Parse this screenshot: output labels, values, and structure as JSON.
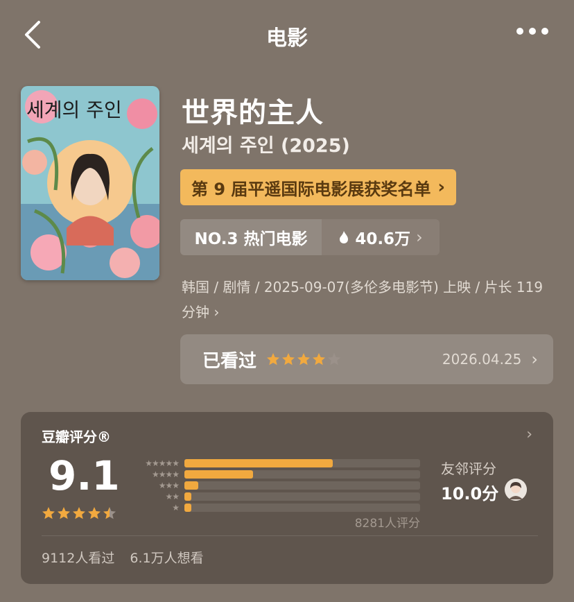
{
  "header": {
    "title": "电影",
    "back_icon": "chevron-left-icon",
    "more_icon": "more-dots-icon"
  },
  "movie": {
    "poster_icon": "movie-poster-image",
    "poster_text": "세계의 주인",
    "title": "世界的主人",
    "original_title": "세계의 주인 (2025)",
    "award_label": "第 9 届平遥国际电影展获奖名单",
    "rank_label": "NO.3 热门电影",
    "heat_value": "40.6万",
    "meta_line": "韩国 / 剧情 / 2025-09-07(多伦多电影节) 上映 / 片长 119 分钟",
    "colors": {
      "award_bg": "#f3b95c",
      "star": "#f1a93f"
    }
  },
  "my_record": {
    "status": "已看过",
    "stars": 4,
    "max_stars": 5,
    "date": "2026.04.25"
  },
  "rating": {
    "title": "豆瓣评分®",
    "score": "9.1",
    "score_stars": 4.5,
    "distribution": [
      {
        "stars": "★★★★★",
        "fraction": 0.63
      },
      {
        "stars": "★★★★",
        "fraction": 0.29
      },
      {
        "stars": "★★★",
        "fraction": 0.06
      },
      {
        "stars": "★★",
        "fraction": 0.03
      },
      {
        "stars": "★",
        "fraction": 0.03
      }
    ],
    "count_label": "8281人评分",
    "friend_label": "友邻评分",
    "friend_score": "10.0分",
    "watched_label": "9112人看过",
    "want_label": "6.1万人想看"
  }
}
